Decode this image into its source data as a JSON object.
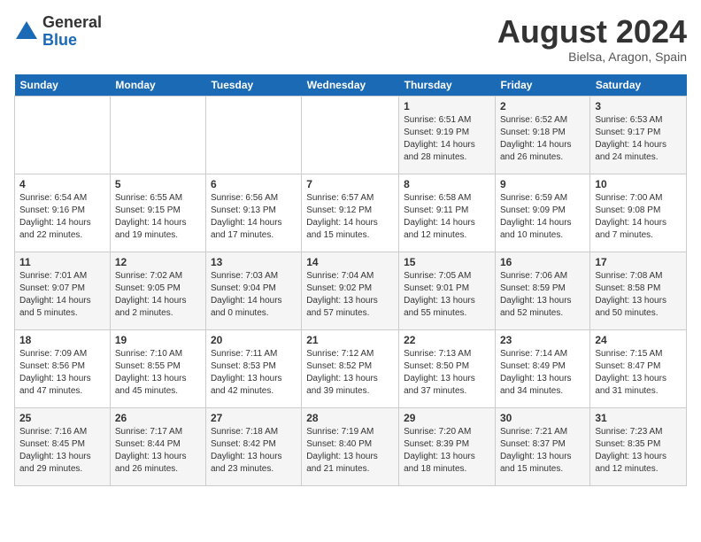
{
  "header": {
    "logo_general": "General",
    "logo_blue": "Blue",
    "month_title": "August 2024",
    "location": "Bielsa, Aragon, Spain"
  },
  "days_of_week": [
    "Sunday",
    "Monday",
    "Tuesday",
    "Wednesday",
    "Thursday",
    "Friday",
    "Saturday"
  ],
  "weeks": [
    [
      {
        "day": "",
        "info": ""
      },
      {
        "day": "",
        "info": ""
      },
      {
        "day": "",
        "info": ""
      },
      {
        "day": "",
        "info": ""
      },
      {
        "day": "1",
        "info": "Sunrise: 6:51 AM\nSunset: 9:19 PM\nDaylight: 14 hours and 28 minutes."
      },
      {
        "day": "2",
        "info": "Sunrise: 6:52 AM\nSunset: 9:18 PM\nDaylight: 14 hours and 26 minutes."
      },
      {
        "day": "3",
        "info": "Sunrise: 6:53 AM\nSunset: 9:17 PM\nDaylight: 14 hours and 24 minutes."
      }
    ],
    [
      {
        "day": "4",
        "info": "Sunrise: 6:54 AM\nSunset: 9:16 PM\nDaylight: 14 hours and 22 minutes."
      },
      {
        "day": "5",
        "info": "Sunrise: 6:55 AM\nSunset: 9:15 PM\nDaylight: 14 hours and 19 minutes."
      },
      {
        "day": "6",
        "info": "Sunrise: 6:56 AM\nSunset: 9:13 PM\nDaylight: 14 hours and 17 minutes."
      },
      {
        "day": "7",
        "info": "Sunrise: 6:57 AM\nSunset: 9:12 PM\nDaylight: 14 hours and 15 minutes."
      },
      {
        "day": "8",
        "info": "Sunrise: 6:58 AM\nSunset: 9:11 PM\nDaylight: 14 hours and 12 minutes."
      },
      {
        "day": "9",
        "info": "Sunrise: 6:59 AM\nSunset: 9:09 PM\nDaylight: 14 hours and 10 minutes."
      },
      {
        "day": "10",
        "info": "Sunrise: 7:00 AM\nSunset: 9:08 PM\nDaylight: 14 hours and 7 minutes."
      }
    ],
    [
      {
        "day": "11",
        "info": "Sunrise: 7:01 AM\nSunset: 9:07 PM\nDaylight: 14 hours and 5 minutes."
      },
      {
        "day": "12",
        "info": "Sunrise: 7:02 AM\nSunset: 9:05 PM\nDaylight: 14 hours and 2 minutes."
      },
      {
        "day": "13",
        "info": "Sunrise: 7:03 AM\nSunset: 9:04 PM\nDaylight: 14 hours and 0 minutes."
      },
      {
        "day": "14",
        "info": "Sunrise: 7:04 AM\nSunset: 9:02 PM\nDaylight: 13 hours and 57 minutes."
      },
      {
        "day": "15",
        "info": "Sunrise: 7:05 AM\nSunset: 9:01 PM\nDaylight: 13 hours and 55 minutes."
      },
      {
        "day": "16",
        "info": "Sunrise: 7:06 AM\nSunset: 8:59 PM\nDaylight: 13 hours and 52 minutes."
      },
      {
        "day": "17",
        "info": "Sunrise: 7:08 AM\nSunset: 8:58 PM\nDaylight: 13 hours and 50 minutes."
      }
    ],
    [
      {
        "day": "18",
        "info": "Sunrise: 7:09 AM\nSunset: 8:56 PM\nDaylight: 13 hours and 47 minutes."
      },
      {
        "day": "19",
        "info": "Sunrise: 7:10 AM\nSunset: 8:55 PM\nDaylight: 13 hours and 45 minutes."
      },
      {
        "day": "20",
        "info": "Sunrise: 7:11 AM\nSunset: 8:53 PM\nDaylight: 13 hours and 42 minutes."
      },
      {
        "day": "21",
        "info": "Sunrise: 7:12 AM\nSunset: 8:52 PM\nDaylight: 13 hours and 39 minutes."
      },
      {
        "day": "22",
        "info": "Sunrise: 7:13 AM\nSunset: 8:50 PM\nDaylight: 13 hours and 37 minutes."
      },
      {
        "day": "23",
        "info": "Sunrise: 7:14 AM\nSunset: 8:49 PM\nDaylight: 13 hours and 34 minutes."
      },
      {
        "day": "24",
        "info": "Sunrise: 7:15 AM\nSunset: 8:47 PM\nDaylight: 13 hours and 31 minutes."
      }
    ],
    [
      {
        "day": "25",
        "info": "Sunrise: 7:16 AM\nSunset: 8:45 PM\nDaylight: 13 hours and 29 minutes."
      },
      {
        "day": "26",
        "info": "Sunrise: 7:17 AM\nSunset: 8:44 PM\nDaylight: 13 hours and 26 minutes."
      },
      {
        "day": "27",
        "info": "Sunrise: 7:18 AM\nSunset: 8:42 PM\nDaylight: 13 hours and 23 minutes."
      },
      {
        "day": "28",
        "info": "Sunrise: 7:19 AM\nSunset: 8:40 PM\nDaylight: 13 hours and 21 minutes."
      },
      {
        "day": "29",
        "info": "Sunrise: 7:20 AM\nSunset: 8:39 PM\nDaylight: 13 hours and 18 minutes."
      },
      {
        "day": "30",
        "info": "Sunrise: 7:21 AM\nSunset: 8:37 PM\nDaylight: 13 hours and 15 minutes."
      },
      {
        "day": "31",
        "info": "Sunrise: 7:23 AM\nSunset: 8:35 PM\nDaylight: 13 hours and 12 minutes."
      }
    ]
  ]
}
